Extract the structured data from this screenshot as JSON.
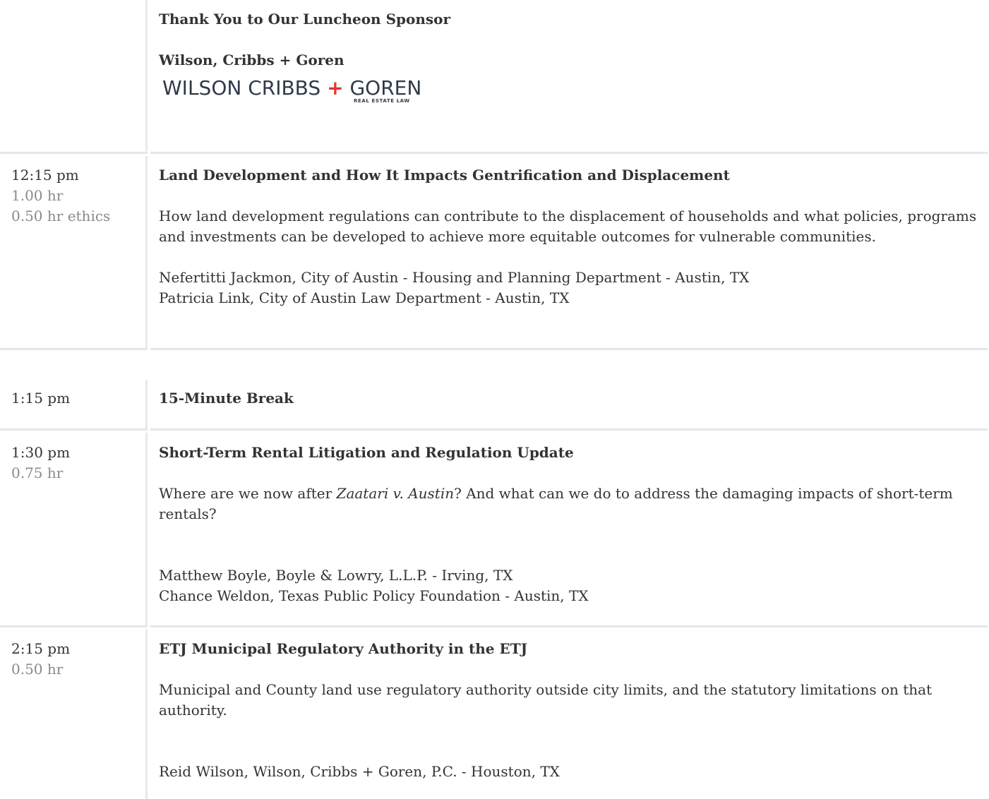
{
  "sponsor": {
    "heading": "Thank You to Our Luncheon Sponsor",
    "name": "Wilson, Cribbs + Goren",
    "logo_main_left": "WILSON CRIBBS",
    "logo_plus": "+",
    "logo_main_right": "GOREN",
    "logo_sub": "REAL ESTATE LAW",
    "logo_color": "#2f3a4a",
    "logo_accent": "#e8322b"
  },
  "sessions": [
    {
      "time": "12:15 pm",
      "credits": [
        "1.00 hr",
        "0.50 hr ethics"
      ],
      "title": "Land Development and How It Impacts Gentrification and Displacement",
      "description": "How land development regulations can contribute to the displacement of households and what policies, programs and investments can be developed to achieve more equitable outcomes for vulnerable communities.",
      "speakers": [
        "Nefertitti Jackmon, City of Austin - Housing and Planning Department - Austin, TX",
        "Patricia Link, City of Austin Law Department - Austin, TX"
      ]
    },
    {
      "time": "1:15 pm",
      "title": "15-Minute Break"
    },
    {
      "time": "1:30 pm",
      "credits": [
        "0.75 hr"
      ],
      "title": "Short-Term Rental Litigation and Regulation Update",
      "description_before": "Where are we now after ",
      "description_italic": "Zaatari v. Austin",
      "description_after": "? And what can we do to address the damaging impacts of short-term rentals?",
      "speakers": [
        "Matthew Boyle, Boyle & Lowry, L.L.P. - Irving, TX",
        "Chance Weldon, Texas Public Policy Foundation - Austin, TX"
      ]
    },
    {
      "time": "2:15 pm",
      "credits": [
        "0.50 hr"
      ],
      "title": "ETJ Municipal Regulatory Authority in the ETJ",
      "description": "Municipal and County land use regulatory authority outside city limits, and the statutory limitations on that authority.",
      "speakers": [
        "Reid Wilson, Wilson, Cribbs + Goren, P.C. - Houston, TX"
      ]
    }
  ],
  "colors": {
    "text": "#333333",
    "muted": "#8a8a8a",
    "divider": "#e6e6e6"
  }
}
